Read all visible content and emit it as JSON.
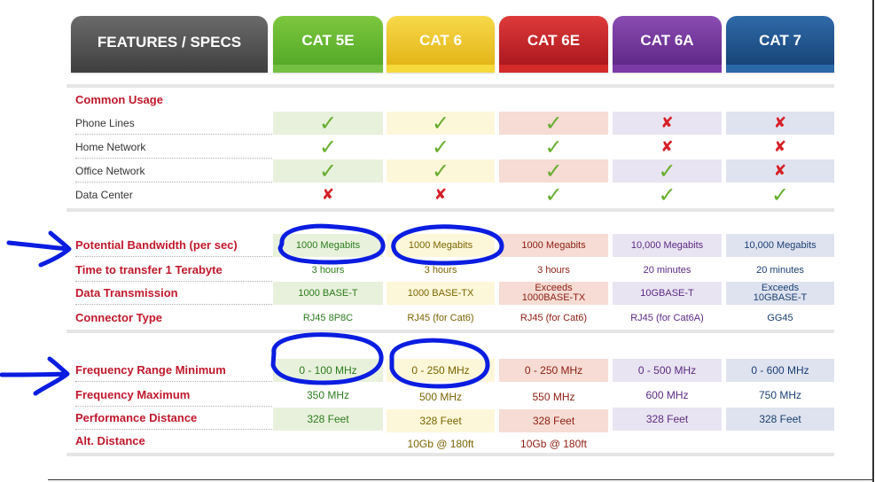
{
  "header": {
    "features_label": "FEATURES / SPECS",
    "columns": [
      {
        "label": "CAT 5E"
      },
      {
        "label": "CAT 6"
      },
      {
        "label": "CAT 6E"
      },
      {
        "label": "CAT 6A"
      },
      {
        "label": "CAT 7"
      }
    ]
  },
  "colors": {
    "features_header": "#4f4f4f",
    "cat5e": "#5bb02a",
    "cat6": "#f0c214",
    "cat6e": "#c01e25",
    "cat6a": "#6a2e8f",
    "cat7": "#1a4f86",
    "label_red": "#c0182c",
    "check": "#66ad2f",
    "cross": "#d61f26",
    "annotation": "#0a1de0"
  },
  "usage": {
    "title": "Common Usage",
    "rows": [
      {
        "label": "Phone Lines",
        "values": [
          "check",
          "check",
          "check",
          "cross",
          "cross"
        ]
      },
      {
        "label": "Home Network",
        "values": [
          "check",
          "check",
          "check",
          "cross",
          "cross"
        ]
      },
      {
        "label": "Office Network",
        "values": [
          "check",
          "check",
          "check",
          "check",
          "cross"
        ]
      },
      {
        "label": "Data Center",
        "values": [
          "cross",
          "cross",
          "check",
          "check",
          "check"
        ]
      }
    ]
  },
  "specs": {
    "rows": [
      {
        "label": "Potential Bandwidth (per sec)",
        "values": [
          "1000 Megabits",
          "1000 Megabits",
          "1000 Megabits",
          "10,000 Megabits",
          "10,000 Megabits"
        ]
      },
      {
        "label": "Time to transfer 1 Terabyte",
        "values": [
          "3 hours",
          "3 hours",
          "3 hours",
          "20 minutes",
          "20 minutes"
        ]
      },
      {
        "label": "Data Transmission",
        "values": [
          "1000 BASE-T",
          "1000 BASE-TX",
          "Exceeds\n1000BASE-TX",
          "10GBASE-T",
          "Exceeds\n10GBASE-T"
        ]
      },
      {
        "label": "Connector Type",
        "values": [
          "RJ45 8P8C",
          "RJ45 (for Cat6)",
          "RJ45 (for Cat6)",
          "RJ45 (for Cat6A)",
          "GG45"
        ]
      }
    ]
  },
  "frequency": {
    "rows": [
      {
        "label": "Frequency Range Minimum",
        "values": [
          "0 - 100 MHz",
          "0 - 250 MHz",
          "0 - 250 MHz",
          "0 - 500 MHz",
          "0 - 600 MHz"
        ]
      },
      {
        "label": "Frequency Maximum",
        "values": [
          "350 MHz",
          "500 MHz",
          "550 MHz",
          "600 MHz",
          "750 MHz"
        ]
      },
      {
        "label": "Performance Distance",
        "values": [
          "328 Feet",
          "328 Feet",
          "328 Feet",
          "328 Feet",
          "328 Feet"
        ]
      },
      {
        "label": "Alt. Distance",
        "values": [
          "",
          "10Gb @ 180ft",
          "10Gb @ 180ft",
          "",
          ""
        ]
      }
    ]
  },
  "icons": {
    "check": "check-icon",
    "cross": "cross-icon",
    "annotation_arrow": "arrow-right-icon"
  }
}
